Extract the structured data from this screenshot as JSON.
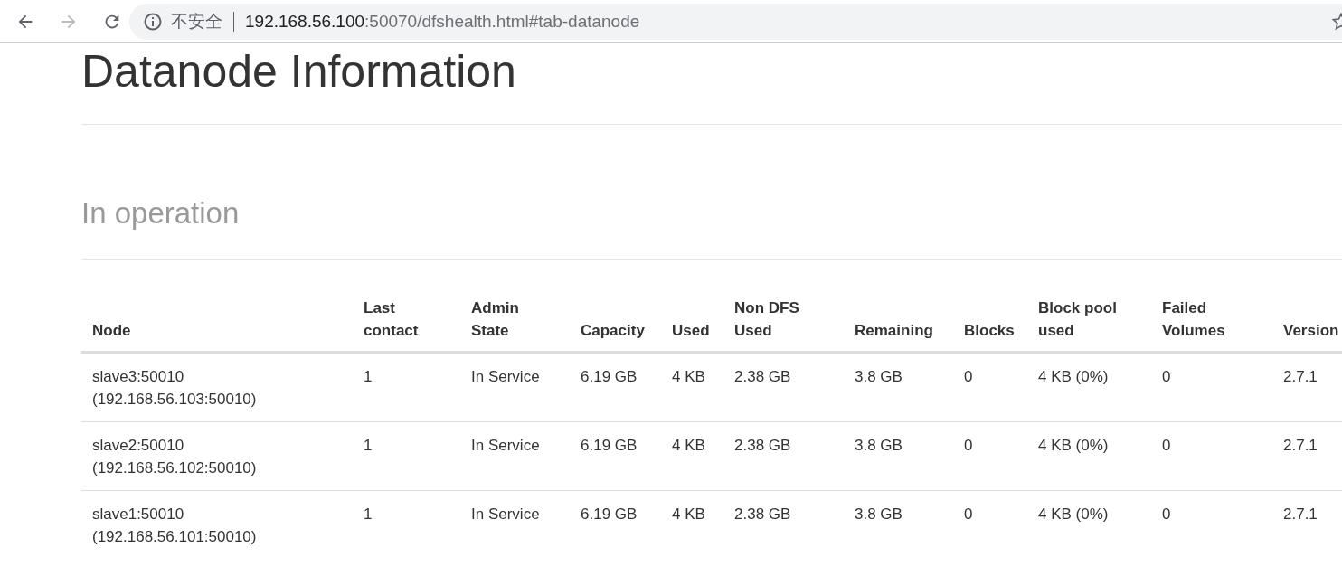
{
  "browser": {
    "nav_buttons": [
      {
        "kind": "back",
        "disabled": false
      },
      {
        "kind": "forward",
        "disabled": true
      },
      {
        "kind": "reload",
        "disabled": false
      }
    ],
    "security_label": "不安全",
    "url_host": "192.168.56.100",
    "url_rest": ":50070/dfshealth.html#tab-datanode"
  },
  "page": {
    "title": "Datanode Information",
    "section": "In operation"
  },
  "table": {
    "columns": [
      "Node",
      "Last contact",
      "Admin State",
      "Capacity",
      "Used",
      "Non DFS Used",
      "Remaining",
      "Blocks",
      "Block pool used",
      "Failed Volumes",
      "Version"
    ],
    "rows": [
      {
        "cells": [
          "slave3:50010\n(192.168.56.103:50010)",
          "1",
          "In Service",
          "6.19 GB",
          "4 KB",
          "2.38 GB",
          "3.8 GB",
          "0",
          "4 KB (0%)",
          "0",
          "2.7.1"
        ]
      },
      {
        "cells": [
          "slave2:50010\n(192.168.56.102:50010)",
          "1",
          "In Service",
          "6.19 GB",
          "4 KB",
          "2.38 GB",
          "3.8 GB",
          "0",
          "4 KB (0%)",
          "0",
          "2.7.1"
        ]
      },
      {
        "cells": [
          "slave1:50010\n(192.168.56.101:50010)",
          "1",
          "In Service",
          "6.19 GB",
          "4 KB",
          "2.38 GB",
          "3.8 GB",
          "0",
          "4 KB (0%)",
          "0",
          "2.7.1"
        ]
      }
    ]
  }
}
